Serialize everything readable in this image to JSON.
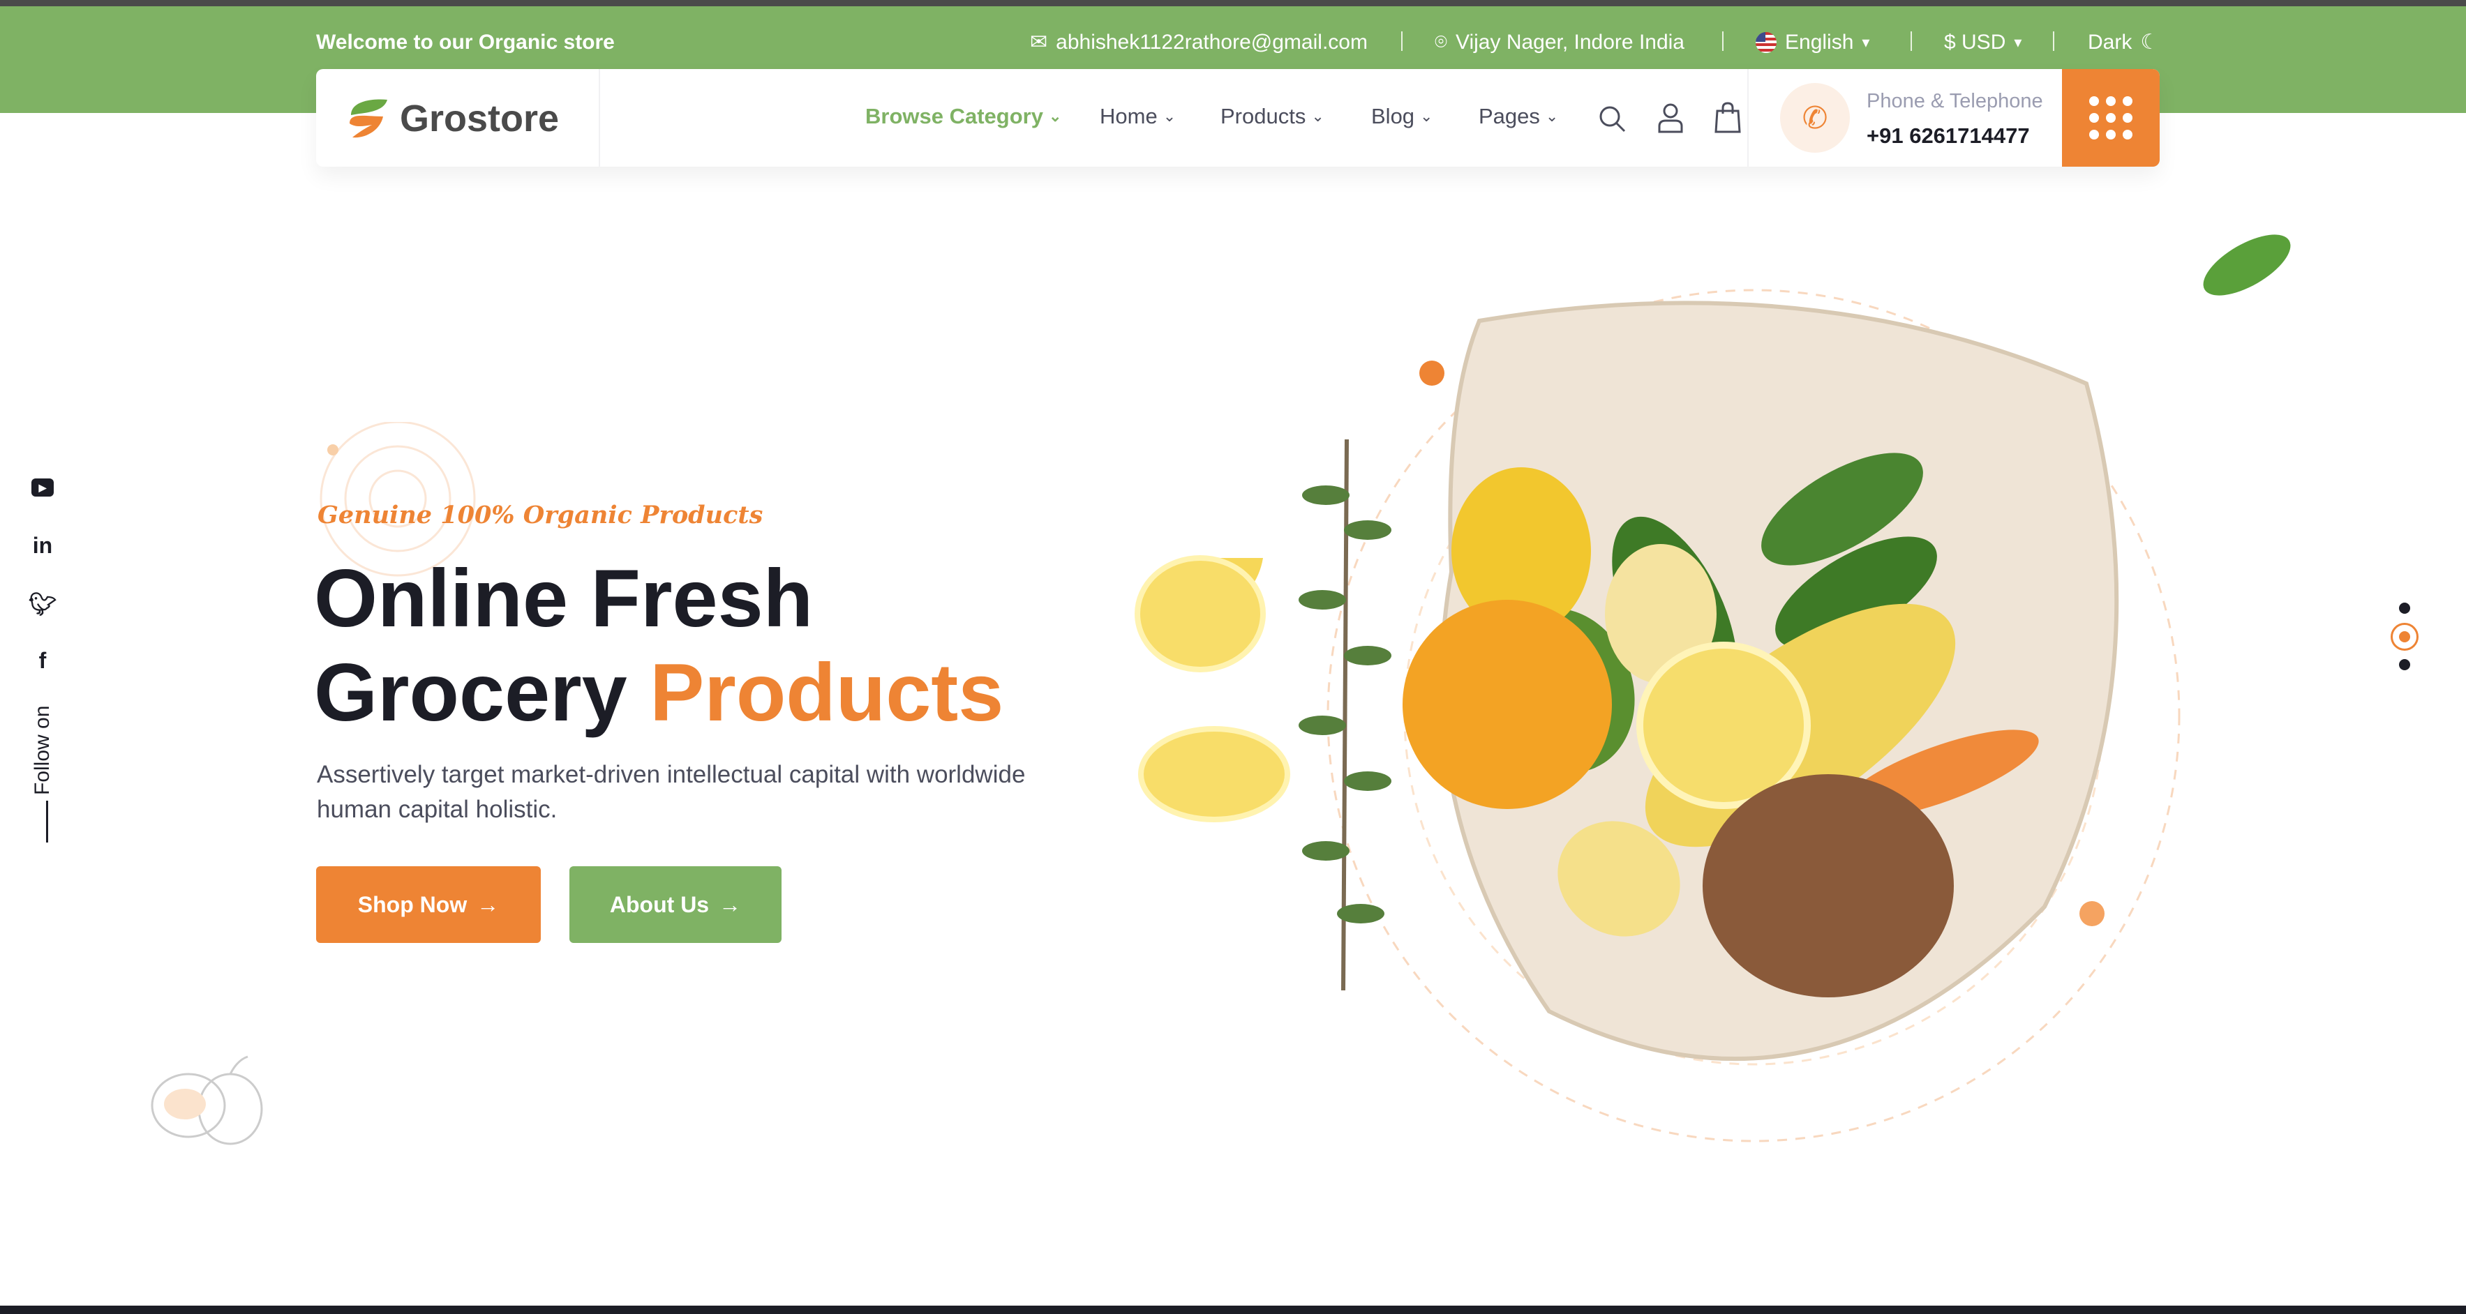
{
  "topbar": {
    "welcome": "Welcome to our Organic store",
    "email": "abhishek1122rathore@gmail.com",
    "location": "Vijay Nager, Indore India",
    "language": "English",
    "currency": "$ USD",
    "theme": "Dark"
  },
  "nav": {
    "logo": "Grostore",
    "items": [
      {
        "label": "Browse Category"
      },
      {
        "label": "Home"
      },
      {
        "label": "Products"
      },
      {
        "label": "Blog"
      },
      {
        "label": "Pages"
      }
    ],
    "phone_label": "Phone & Telephone",
    "phone_number": "+91 6261714477"
  },
  "hero": {
    "tagline": "Genuine 100% Organic Products",
    "title_line1": "Online Fresh",
    "title_line2_a": "Grocery",
    "title_line2_b": "Products",
    "description_line1": "Assertively target market-driven intellectual capital with worldwide",
    "description_line2": "human capital holistic.",
    "shop_now": "Shop Now",
    "about_us": "About Us"
  },
  "social": {
    "follow_label": "Follow on"
  },
  "colors": {
    "green": "#7fb264",
    "orange": "#ee8434",
    "dark": "#1c1d26"
  }
}
